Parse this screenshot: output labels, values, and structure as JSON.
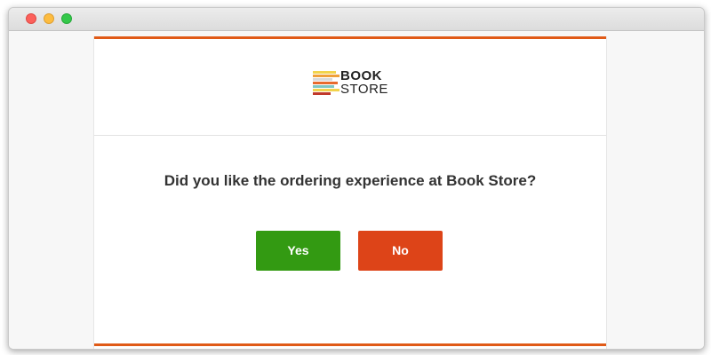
{
  "window": {
    "controls": [
      "close-icon",
      "minimize-icon",
      "maximize-icon"
    ]
  },
  "email": {
    "logo": {
      "line1": "BOOK",
      "line2": "STORE",
      "stripe_colors": [
        "#f2d34c",
        "#f0a03a",
        "#d9d9d9",
        "#e86a2c",
        "#7fc6c2",
        "#f2d34c",
        "#c0392b"
      ]
    },
    "question": "Did you like the ordering experience at Book Store?",
    "buttons": {
      "yes_label": "Yes",
      "no_label": "No"
    }
  },
  "colors": {
    "accent": "#e05a17",
    "yes": "#339a12",
    "no": "#dd4418"
  }
}
